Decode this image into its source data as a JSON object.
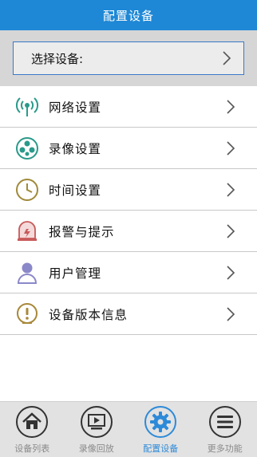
{
  "header": {
    "title": "配置设备"
  },
  "selector": {
    "label": "选择设备:"
  },
  "menu": [
    {
      "label": "网络设置",
      "icon": "wifi-signal-icon"
    },
    {
      "label": "录像设置",
      "icon": "film-reel-icon"
    },
    {
      "label": "时间设置",
      "icon": "clock-icon"
    },
    {
      "label": "报警与提示",
      "icon": "alarm-icon"
    },
    {
      "label": "用户管理",
      "icon": "user-icon"
    },
    {
      "label": "设备版本信息",
      "icon": "info-exclamation-icon"
    }
  ],
  "tabs": [
    {
      "label": "设备列表",
      "icon": "home-icon",
      "active": false
    },
    {
      "label": "录像回放",
      "icon": "playback-icon",
      "active": false
    },
    {
      "label": "配置设备",
      "icon": "gear-icon",
      "active": true
    },
    {
      "label": "更多功能",
      "icon": "menu-icon",
      "active": false
    }
  ],
  "colors": {
    "header": "#1e88d6",
    "accent": "#2d8ad8",
    "selector_border": "#3a78c8"
  }
}
